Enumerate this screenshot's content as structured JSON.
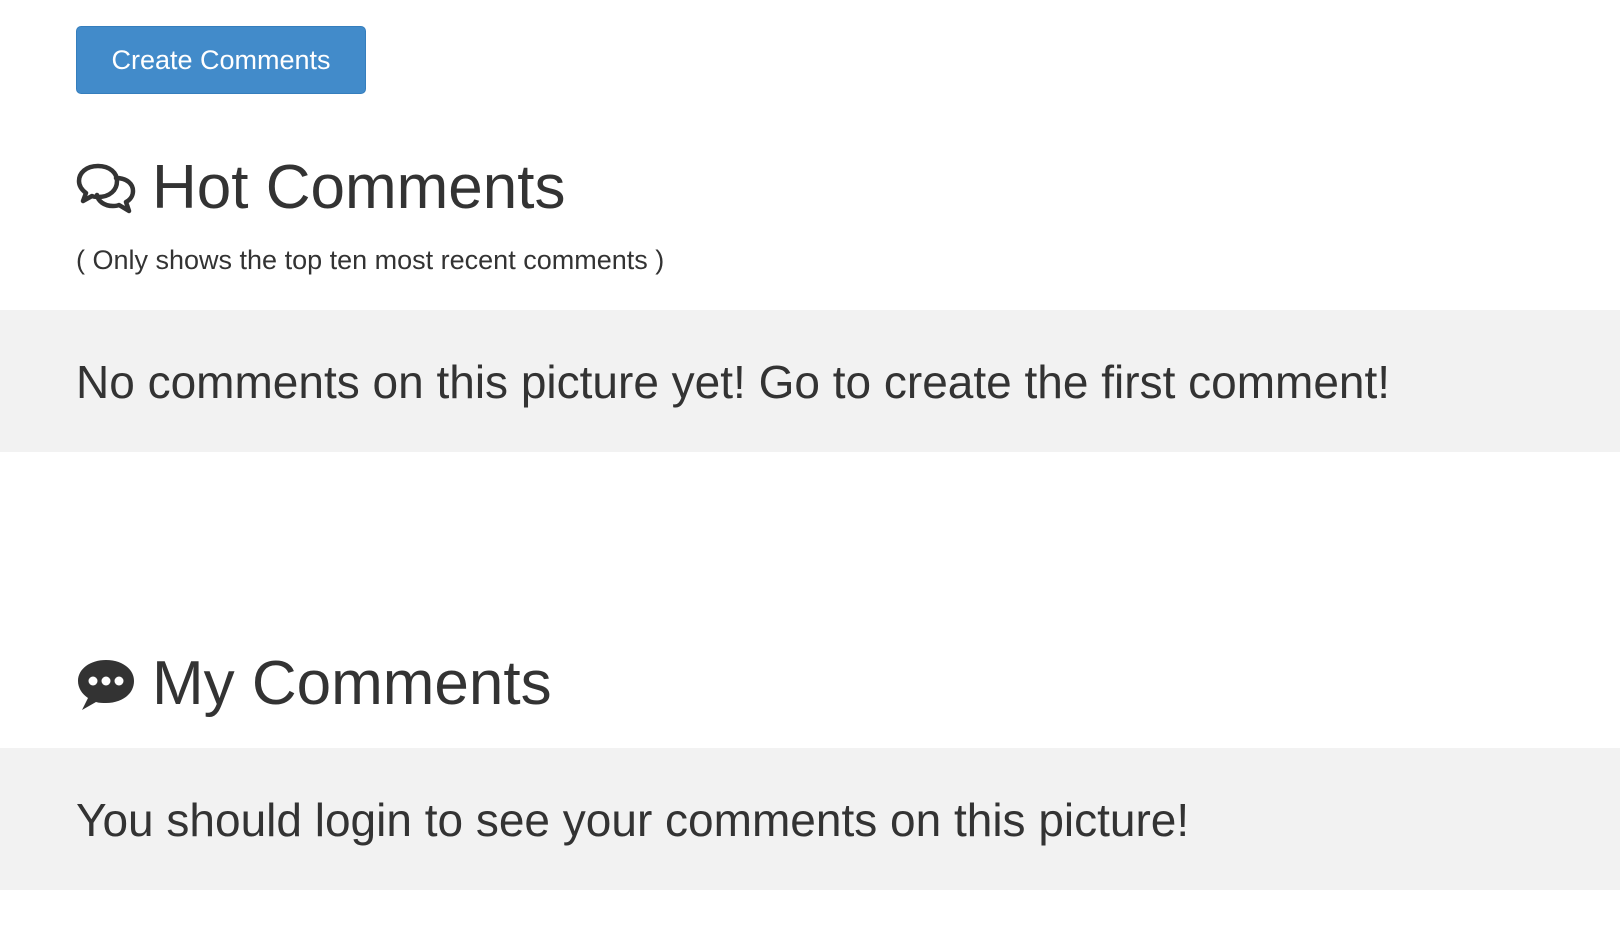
{
  "toolbar": {
    "create_label": "Create Comments"
  },
  "hot_comments": {
    "title": "Hot Comments",
    "icon": "comments-outline-icon",
    "note": "( Only shows the top ten most recent comments )",
    "empty_message": "No comments on this picture yet! Go to create the first comment!"
  },
  "my_comments": {
    "title": "My Comments",
    "icon": "comment-dots-icon",
    "login_message": "You should login to see your comments on this picture!"
  },
  "colors": {
    "primary_button": "#428bca",
    "well_background": "#f2f2f2",
    "text": "#333333"
  }
}
